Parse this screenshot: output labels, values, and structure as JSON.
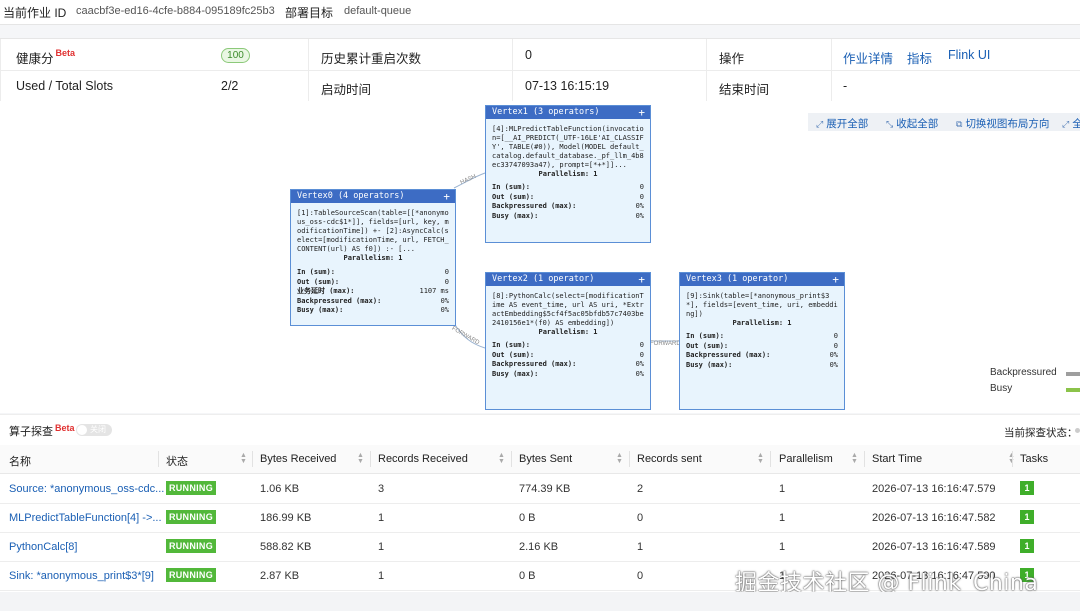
{
  "job": {
    "id_label": "当前作业 ID",
    "id_value": "caacbf3e-ed16-4cfe-b884-095189fc25b3",
    "target_label": "部署目标",
    "target_value": "default-queue"
  },
  "info": {
    "health_label": "健康分",
    "beta": "Beta",
    "health_score": "100",
    "restarts_label": "历史累计重启次数",
    "restarts_value": "0",
    "ops_label": "操作",
    "op_links": [
      "作业详情",
      "指标",
      "Flink UI"
    ],
    "slots_label": "Used / Total Slots",
    "slots_value": "2/2",
    "start_label": "启动时间",
    "start_value": "07-13 16:15:19",
    "end_label": "结束时间",
    "end_value": "-"
  },
  "graph_tools": {
    "expand_all": "展开全部",
    "collapse_all": "收起全部",
    "switch_layout": "切换视图布局方向",
    "more": "全"
  },
  "vertices": [
    {
      "title": "Vertex0 (4 operators)",
      "desc": "[1]:TableSourceScan(table=[[*anonymous_oss-cdc$1*]], fields=[url, key, modificationTime]) +- [2]:AsyncCalc(select=[modificationTime, url, FETCH_CONTENT(url) AS f0]) :- [...",
      "parallelism": "Parallelism: 1",
      "stats": [
        [
          "In (sum):",
          "0"
        ],
        [
          "Out (sum):",
          "0"
        ],
        [
          "业务延时 (max):",
          "1107 ms"
        ],
        [
          "Backpressured (max):",
          "0%"
        ],
        [
          "Busy (max):",
          "0%"
        ]
      ]
    },
    {
      "title": "Vertex1 (3 operators)",
      "desc": "[4]:MLPredictTableFunction(invocation=[__AI_PREDICT(_UTF-16LE'AI_CLASSIFY', TABLE(#0)), Model(MODEL default_catalog.default_database._pf_llm_4b8ec33747093a47), prompt=[*+*]]...",
      "parallelism": "Parallelism: 1",
      "stats": [
        [
          "In (sum):",
          "0"
        ],
        [
          "Out (sum):",
          "0"
        ],
        [
          "Backpressured (max):",
          "0%"
        ],
        [
          "Busy (max):",
          "0%"
        ]
      ]
    },
    {
      "title": "Vertex2 (1 operator)",
      "desc": "[8]:PythonCalc(select=[modificationTime AS event_time, url AS uri, *ExtractEmbedding$5cf4f5ac05bfdb57c7403be2410156e1*(f0) AS embedding])",
      "parallelism": "Parallelism: 1",
      "stats": [
        [
          "In (sum):",
          "0"
        ],
        [
          "Out (sum):",
          "0"
        ],
        [
          "Backpressured (max):",
          "0%"
        ],
        [
          "Busy (max):",
          "0%"
        ]
      ]
    },
    {
      "title": "Vertex3 (1 operator)",
      "desc": "[9]:Sink(table=[*anonymous_print$3*], fields=[event_time, uri, embedding])",
      "parallelism": "Parallelism: 1",
      "stats": [
        [
          "In (sum):",
          "0"
        ],
        [
          "Out (sum):",
          "0"
        ],
        [
          "Backpressured (max):",
          "0%"
        ],
        [
          "Busy (max):",
          "0%"
        ]
      ]
    }
  ],
  "edges": {
    "hash": "HASH",
    "forward1": "FORWARD",
    "forward2": "FORWARD"
  },
  "legend": {
    "backpressured": "Backpressured",
    "busy": "Busy",
    "backpressured_color": "#9e9e9e",
    "busy_color": "#8bc34a"
  },
  "probe": {
    "title": "算子探查",
    "beta": "Beta",
    "toggle_text": "关闭",
    "state_label": "当前探查状态："
  },
  "table": {
    "headers": [
      "名称",
      "状态",
      "Bytes Received",
      "Records Received",
      "Bytes Sent",
      "Records sent",
      "Parallelism",
      "Start Time",
      "Tasks"
    ],
    "rows": [
      {
        "name": "Source: *anonymous_oss-cdc...",
        "status": "RUNNING",
        "bytes_received": "1.06 KB",
        "records_received": "3",
        "bytes_sent": "774.39 KB",
        "records_sent": "2",
        "parallelism": "1",
        "start_time": "2026-07-13 16:16:47.579",
        "tasks": "1"
      },
      {
        "name": "MLPredictTableFunction[4] ->...",
        "status": "RUNNING",
        "bytes_received": "186.99 KB",
        "records_received": "1",
        "bytes_sent": "0 B",
        "records_sent": "0",
        "parallelism": "1",
        "start_time": "2026-07-13 16:16:47.582",
        "tasks": "1"
      },
      {
        "name": "PythonCalc[8]",
        "status": "RUNNING",
        "bytes_received": "588.82 KB",
        "records_received": "1",
        "bytes_sent": "2.16 KB",
        "records_sent": "1",
        "parallelism": "1",
        "start_time": "2026-07-13 16:16:47.589",
        "tasks": "1"
      },
      {
        "name": "Sink: *anonymous_print$3*[9]",
        "status": "RUNNING",
        "bytes_received": "2.87 KB",
        "records_received": "1",
        "bytes_sent": "0 B",
        "records_sent": "0",
        "parallelism": "1",
        "start_time": "2026-07-13 16:16:47.590",
        "tasks": "1"
      }
    ]
  },
  "watermark": "掘金技术社区 @ Flink_China"
}
